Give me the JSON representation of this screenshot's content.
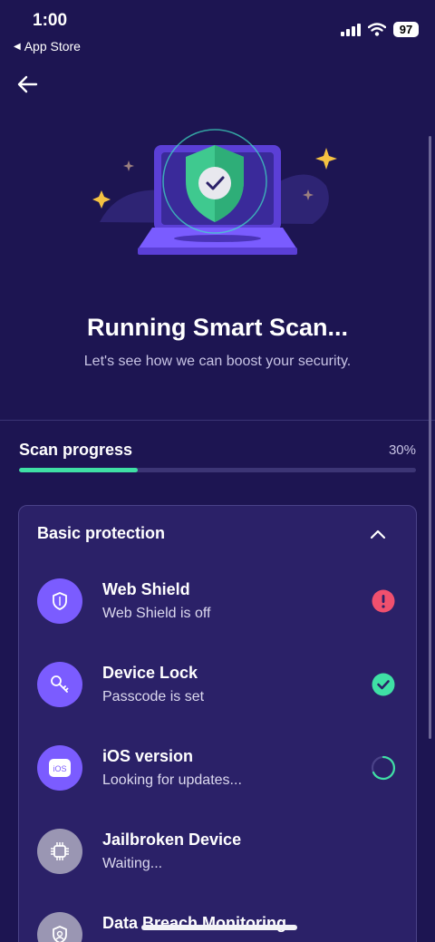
{
  "status_bar": {
    "time": "1:00",
    "back_app": "App Store",
    "battery": "97"
  },
  "header": {
    "title": "Running Smart Scan...",
    "subtitle": "Let's see how we can boost your security."
  },
  "progress": {
    "label": "Scan progress",
    "percent_text": "30%",
    "fraction": 0.3
  },
  "section": {
    "title": "Basic protection",
    "items": [
      {
        "title": "Web Shield",
        "subtitle": "Web Shield is off",
        "icon": "shield-icon",
        "status": "warning"
      },
      {
        "title": "Device Lock",
        "subtitle": "Passcode is set",
        "icon": "key-icon",
        "status": "ok"
      },
      {
        "title": "iOS version",
        "subtitle": "Looking for updates...",
        "icon": "ios-icon",
        "status": "loading"
      },
      {
        "title": "Jailbroken Device",
        "subtitle": "Waiting...",
        "icon": "chip-icon",
        "status": "waiting"
      },
      {
        "title": "Data Breach Monitoring",
        "subtitle": "",
        "icon": "user-shield-icon",
        "status": "waiting"
      }
    ]
  },
  "colors": {
    "background": "#1d1552",
    "card": "#2b2168",
    "accent_purple": "#7b5cff",
    "accent_green": "#3fe0a5",
    "warning_red": "#f0506e"
  }
}
